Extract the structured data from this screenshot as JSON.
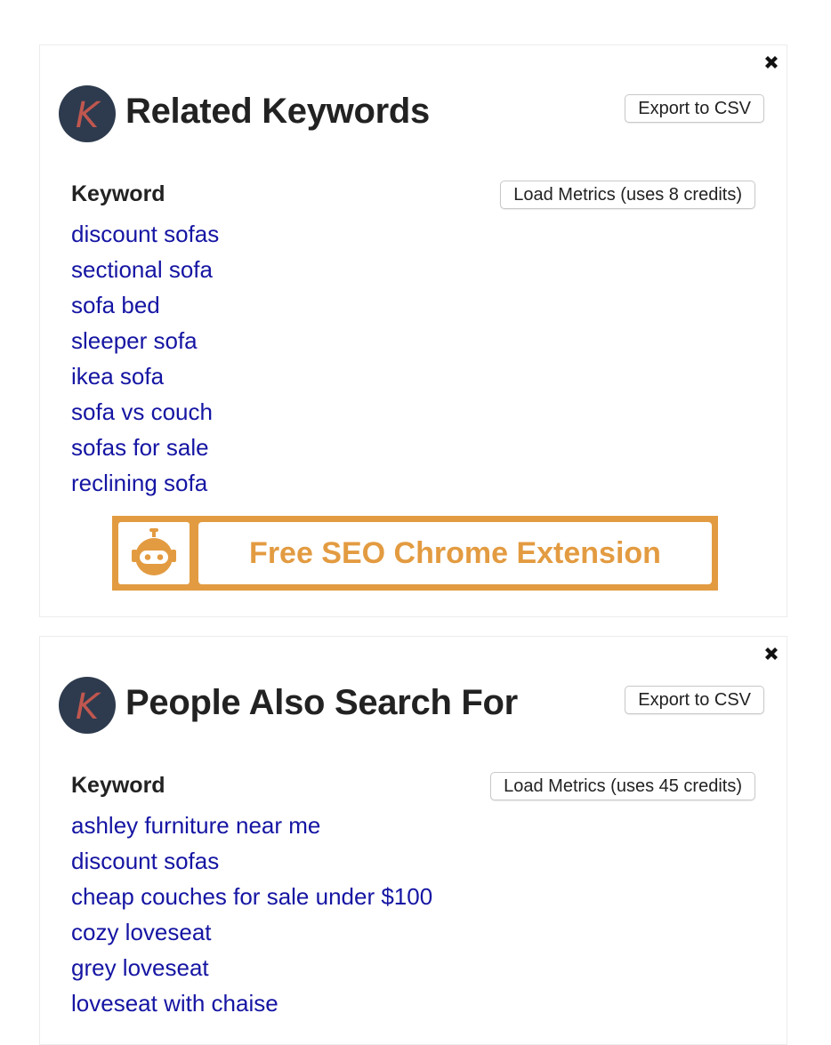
{
  "colors": {
    "title": "#222222",
    "link": "#1515a3",
    "logo_bg": "#2e3b4e",
    "logo_letter": "#c0574f",
    "promo_accent": "#e39b41",
    "panel_border": "#ececec"
  },
  "panels": [
    {
      "id": "related-keywords",
      "close_icon": "close-x-icon",
      "logo_letter": "K",
      "title": "Related Keywords",
      "export_label": "Export to CSV",
      "column_header": "Keyword",
      "load_metrics_label": "Load Metrics (uses 8 credits)",
      "keywords": [
        "discount sofas",
        "sectional sofa",
        "sofa bed",
        "sleeper sofa",
        "ikea sofa",
        "sofa vs couch",
        "sofas for sale",
        "reclining sofa"
      ],
      "promo": {
        "icon": "robot-icon",
        "text": "Free SEO Chrome Extension"
      }
    },
    {
      "id": "people-also-search-for",
      "close_icon": "close-x-icon",
      "logo_letter": "K",
      "title": "People Also Search For",
      "export_label": "Export to CSV",
      "column_header": "Keyword",
      "load_metrics_label": "Load Metrics (uses 45 credits)",
      "keywords": [
        "ashley furniture near me",
        "discount sofas",
        "cheap couches for sale under $100",
        "cozy loveseat",
        "grey loveseat",
        "loveseat with chaise"
      ]
    }
  ]
}
